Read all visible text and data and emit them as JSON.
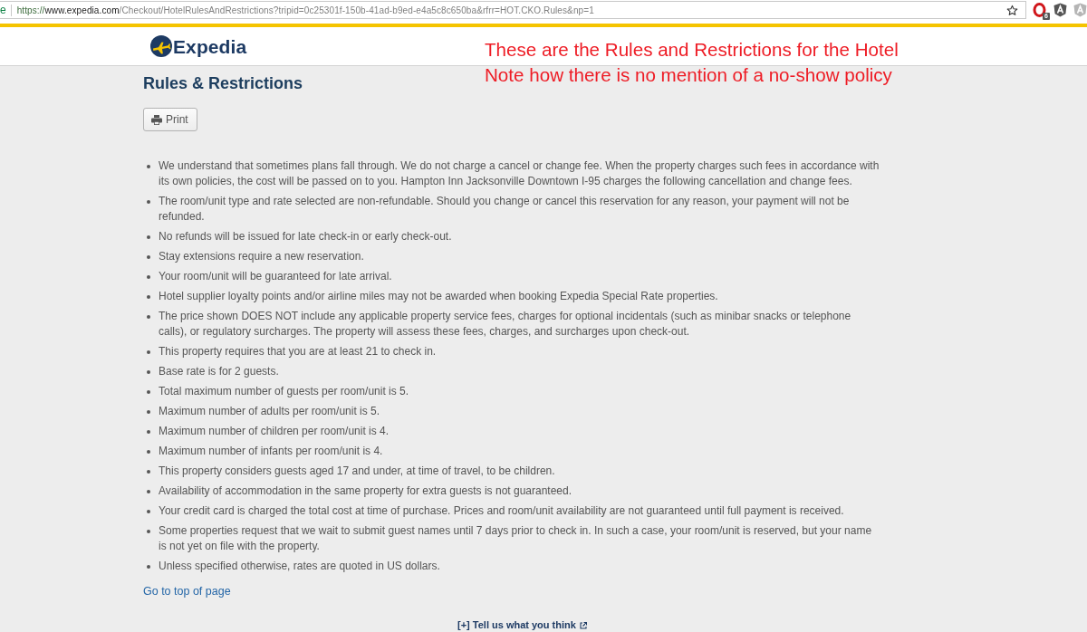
{
  "browser": {
    "secure_label": "e",
    "url": {
      "scheme": "https://",
      "host": "www.expedia.com",
      "path": "/Checkout/HotelRulesAndRestrictions?tripid=0c25301f-150b-41ad-b9ed-e4a5c8c650ba&rfrr=HOT.CKO.Rules&np=1"
    },
    "extensions": [
      {
        "kind": "ring",
        "badge": "6",
        "disabled": false
      },
      {
        "kind": "shield",
        "disabled": false
      },
      {
        "kind": "shield",
        "disabled": true
      }
    ]
  },
  "header": {
    "logo_text": "Expedia"
  },
  "annotation": {
    "lines": [
      "These are the Rules and Restrictions for the Hotel",
      "Note how there is no mention of a no-show policy"
    ]
  },
  "page": {
    "title": "Rules & Restrictions",
    "print_button": "Print",
    "rules": [
      "We understand that sometimes plans fall through. We do not charge a cancel or change fee. When the property charges such fees in accordance with its own policies, the cost will be passed on to you. Hampton Inn Jacksonville Downtown I-95 charges the following cancellation and change fees.",
      "The room/unit type and rate selected are non-refundable. Should you change or cancel this reservation for any reason, your payment will not be refunded.",
      "No refunds will be issued for late check-in or early check-out.",
      "Stay extensions require a new reservation.",
      "Your room/unit will be guaranteed for late arrival.",
      "Hotel supplier loyalty points and/or airline miles may not be awarded when booking Expedia Special Rate properties.",
      "The price shown DOES NOT include any applicable property service fees, charges for optional incidentals (such as minibar snacks or telephone calls), or regulatory surcharges. The property will assess these fees, charges, and surcharges upon check-out.",
      "This property requires that you are at least 21 to check in.",
      "Base rate is for 2 guests.",
      "Total maximum number of guests per room/unit is 5.",
      "Maximum number of adults per room/unit is 5.",
      "Maximum number of children per room/unit is 4.",
      "Maximum number of infants per room/unit is 4.",
      "This property considers guests aged 17 and under, at time of travel, to be children.",
      "Availability of accommodation in the same property for extra guests is not guaranteed.",
      "Your credit card is charged the total cost at time of purchase. Prices and room/unit availability are not guaranteed until full payment is received.",
      "Some properties request that we wait to submit guest names until 7 days prior to check in. In such a case, your room/unit is reserved, but your name is not yet on file with the property.",
      "Unless specified otherwise, rates are quoted in US dollars."
    ],
    "top_link": "Go to top of page",
    "feedback_link": "[+] Tell us what you think"
  }
}
